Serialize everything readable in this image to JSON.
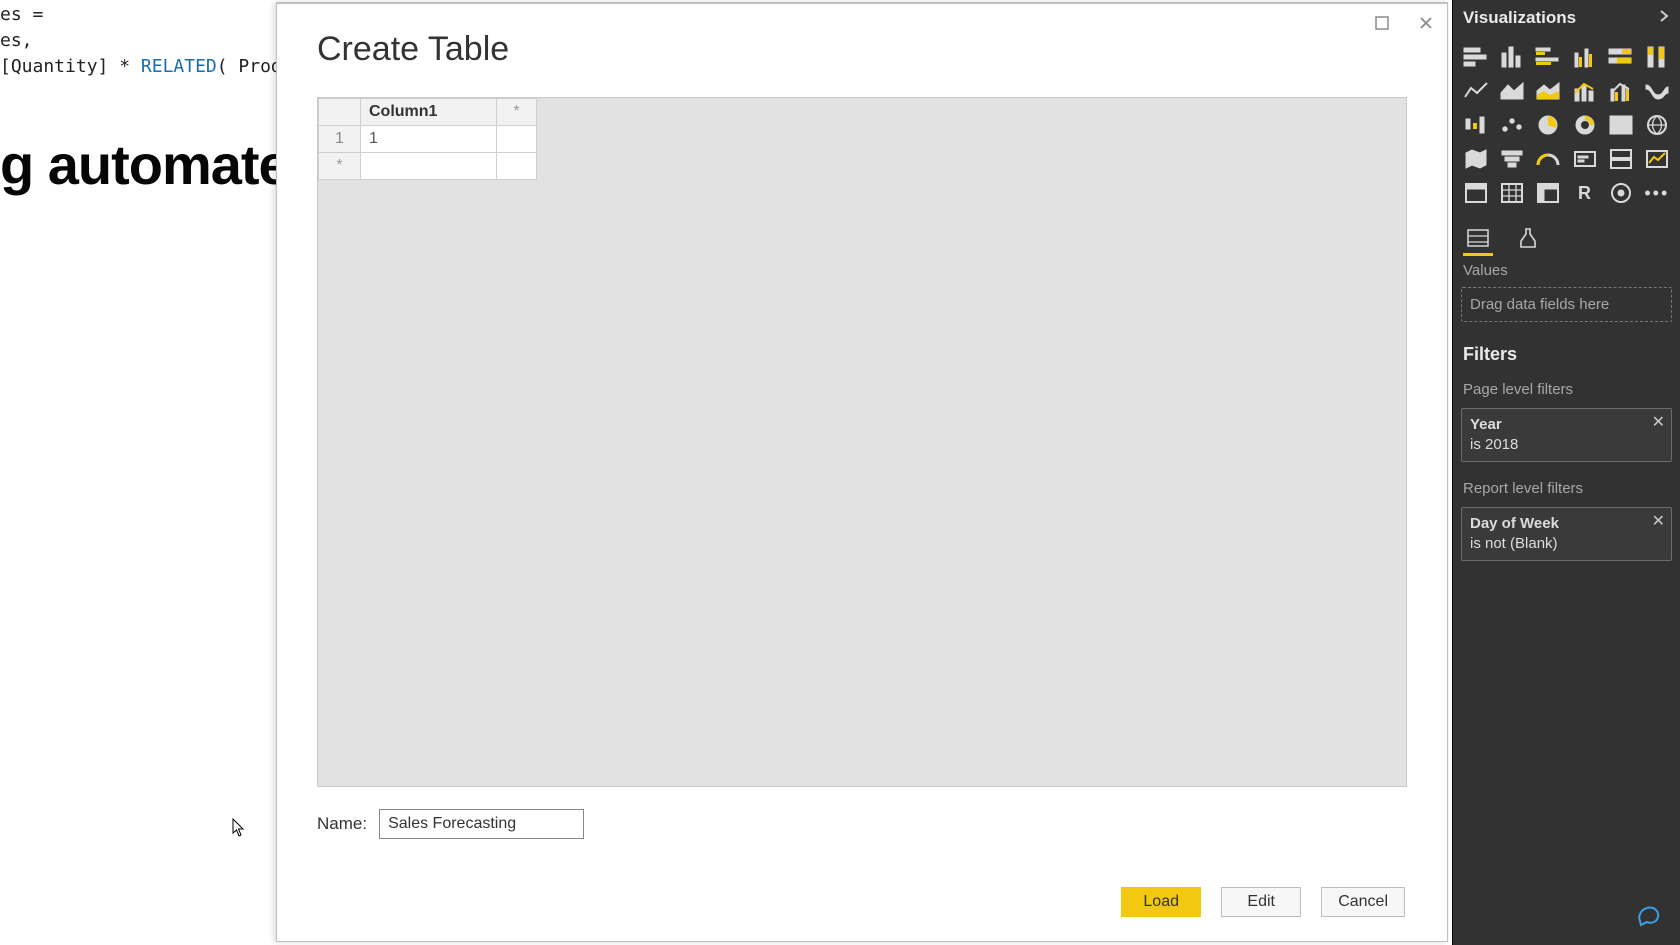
{
  "background": {
    "code_line1": "es =",
    "code_line2": "es,",
    "code_line3_pre": "[Quantity] * ",
    "code_keyword": "RELATED",
    "code_line3_post": "( Products[",
    "big_heading": "g automated"
  },
  "dialog": {
    "title": "Create Table",
    "window": {
      "maximize_tooltip": "Maximize",
      "close_tooltip": "Close"
    },
    "table": {
      "column_header": "Column1",
      "add_column_marker": "*",
      "row_number": "1",
      "cell_value": "1",
      "add_row_marker": "*"
    },
    "name_label": "Name:",
    "name_value": "Sales Forecasting",
    "buttons": {
      "load": "Load",
      "edit": "Edit",
      "cancel": "Cancel"
    }
  },
  "viz_panel": {
    "title": "Visualizations",
    "expand_tooltip": "Expand",
    "values_label": "Values",
    "values_placeholder": "Drag data fields here",
    "filters_heading": "Filters",
    "page_filters_label": "Page level filters",
    "report_filters_label": "Report level filters",
    "filter1": {
      "title": "Year",
      "condition": "is 2018"
    },
    "filter2": {
      "title": "Day of Week",
      "condition": "is not (Blank)"
    },
    "viz_icons": [
      "stacked-bar-chart",
      "stacked-column-chart",
      "clustered-bar-chart",
      "clustered-column-chart",
      "hundred-percent-bar-chart",
      "hundred-percent-column-chart",
      "line-chart",
      "area-chart",
      "stacked-area-chart",
      "line-stacked-column-chart",
      "line-clustered-column-chart",
      "ribbon-chart",
      "waterfall-chart",
      "scatter-chart",
      "pie-chart",
      "donut-chart",
      "treemap-chart",
      "map-chart",
      "filled-map-chart",
      "funnel-chart",
      "gauge-chart",
      "card-visual",
      "multi-row-card",
      "kpi-visual",
      "slicer-visual",
      "table-visual",
      "matrix-visual",
      "r-script-visual",
      "arcgis-map",
      "more-visuals"
    ]
  }
}
